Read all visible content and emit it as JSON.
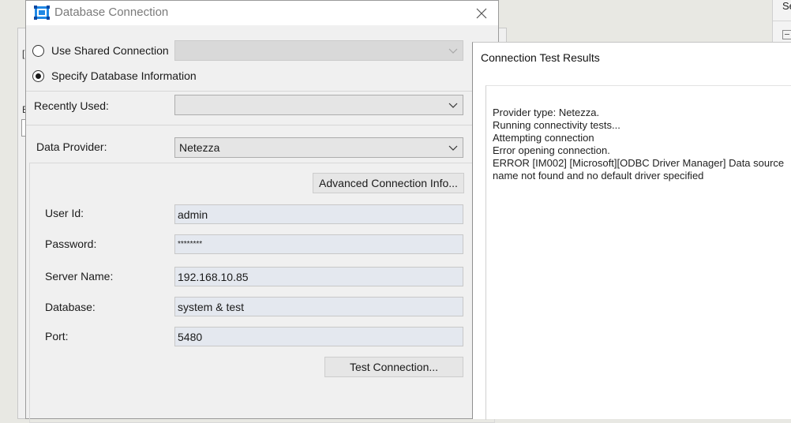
{
  "background": {
    "left_labels": [
      "[",
      "E",
      "["
    ],
    "right_panel_text": "Se"
  },
  "dialog": {
    "title": "Database Connection",
    "radio_shared": "Use Shared Connection",
    "radio_specify": "Specify Database Information",
    "selected_mode": "specify",
    "recently_used_label": "Recently Used:",
    "recently_used_value": "",
    "data_provider_label": "Data Provider:",
    "data_provider_value": "Netezza",
    "advanced_button": "Advanced Connection Info...",
    "user_id_label": "User Id:",
    "user_id_value": "admin",
    "password_label": "Password:",
    "password_value": "********",
    "server_label": "Server Name:",
    "server_value": "192.168.10.85",
    "database_label": "Database:",
    "database_value": "system & test",
    "port_label": "Port:",
    "port_value": "5480",
    "test_button": "Test Connection..."
  },
  "results": {
    "title": "Connection Test Results",
    "text": "Provider type: Netezza.\nRunning connectivity tests...\nAttempting connection\nError opening connection.\nERROR [IM002] [Microsoft][ODBC Driver Manager] Data source name not found and no default driver specified"
  },
  "colors": {
    "field_bg": "#e4e8ef",
    "title_text": "#7a7a7a",
    "icon_blue": "#1e88e5"
  }
}
